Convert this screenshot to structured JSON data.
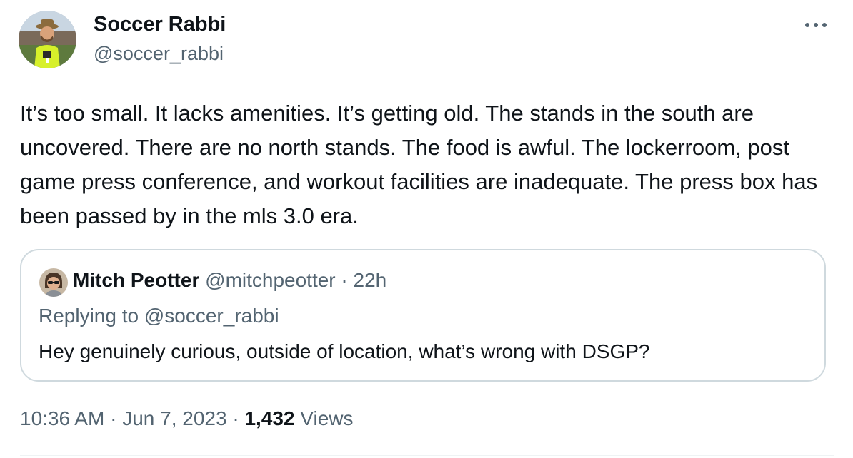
{
  "author": {
    "name": "Soccer Rabbi",
    "handle": "@soccer_rabbi",
    "avatar": "profile-photo-man-hat-yellow-vest"
  },
  "more_icon": "ellipsis-icon",
  "tweet": {
    "text": "It’s too small. It lacks amenities. It’s getting old. The stands in the south are uncovered. There are no north stands. The food is awful. The lockerroom, post game press conference, and workout facilities are inadequate. The press box has been passed by in the mls 3.0 era."
  },
  "quote": {
    "name": "Mitch Peotter",
    "handle": "@mitchpeotter",
    "separator": "·",
    "time": "22h",
    "replying_to": "Replying to @soccer_rabbi",
    "text": "Hey genuinely curious, outside of location, what’s wrong with DSGP?",
    "avatar": "profile-photo-man-sunglasses"
  },
  "meta": {
    "time": "10:36 AM",
    "separator": "·",
    "date": "Jun 7, 2023",
    "views_count": "1,432",
    "views_label": "Views"
  },
  "colors": {
    "text_primary": "#0f1419",
    "text_secondary": "#536471",
    "border": "#cfd9de"
  }
}
